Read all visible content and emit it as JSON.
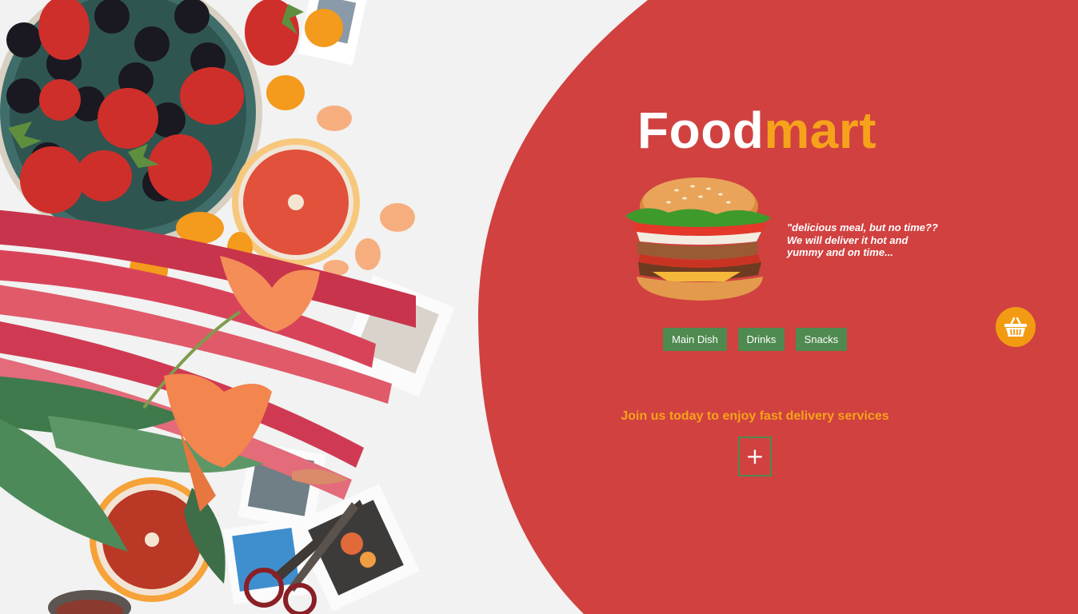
{
  "brand": {
    "part1": "Food",
    "part2": "mart",
    "color_white": "#ffffff",
    "color_accent": "#f6a21b"
  },
  "hero": {
    "image": "flat-lay-fruits-rhubarb-flowers-photo",
    "tagline": "\"delicious meal, but no time?? We will deliver it hot and yummy and on time..."
  },
  "burger": {
    "image": "burger-image"
  },
  "categories": [
    {
      "label": "Main Dish"
    },
    {
      "label": "Drinks"
    },
    {
      "label": "Snacks"
    }
  ],
  "cart": {
    "icon": "basket-icon"
  },
  "cta": {
    "text": "Join us today to enjoy fast delivery services",
    "button_icon": "plus-icon",
    "button_label": "+"
  },
  "colors": {
    "panel_red": "#d04140",
    "button_green": "#4f8a50",
    "basket_orange": "#f29b12",
    "background": "#f1f2f1"
  }
}
